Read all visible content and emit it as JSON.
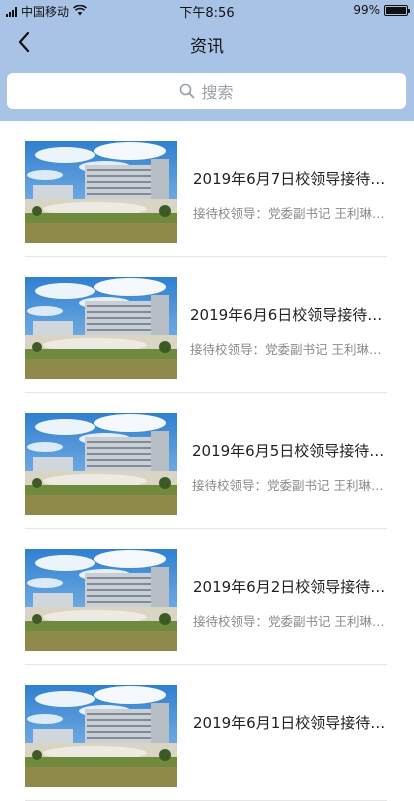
{
  "status_bar": {
    "carrier": "中国移动",
    "time": "下午8:56",
    "battery": "99%",
    "battery_level": 0.99
  },
  "nav": {
    "title": "资讯"
  },
  "search": {
    "placeholder": "搜索"
  },
  "items": [
    {
      "title": "2019年6月7日校领导接待日…",
      "subtitle": "接待校领导：党委副书记 王利琳…"
    },
    {
      "title": "2019年6月6日校领导接待日…",
      "subtitle": "接待校领导：党委副书记 王利琳…"
    },
    {
      "title": "2019年6月5日校领导接待日…",
      "subtitle": "接待校领导：党委副书记 王利琳…"
    },
    {
      "title": "2019年6月2日校领导接待日…",
      "subtitle": "接待校领导：党委副书记 王利琳…"
    },
    {
      "title": "2019年6月1日校领导接待日…",
      "subtitle": ""
    }
  ]
}
